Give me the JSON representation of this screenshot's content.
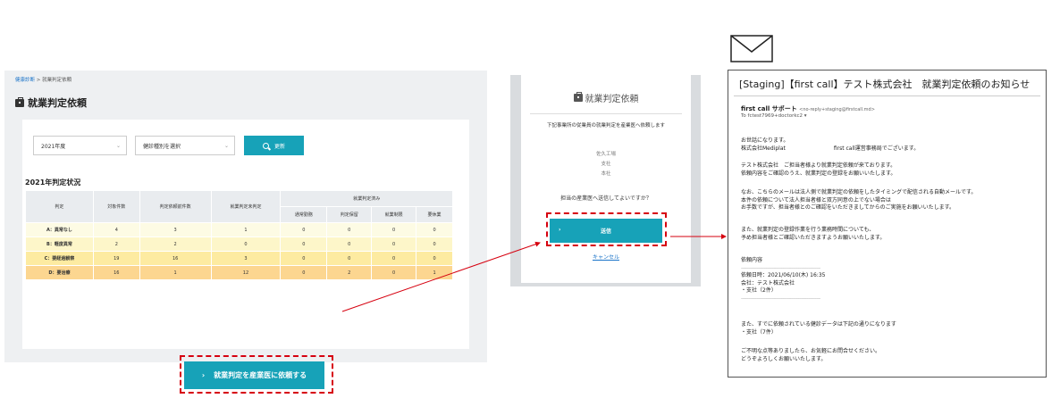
{
  "panel1": {
    "breadcrumb": {
      "link": "健康診断",
      "sep": " > ",
      "current": "就業判定依頼"
    },
    "page_title": "就業判定依頼",
    "filters": {
      "year": "2021年度",
      "exam_type": "健診種別を選択",
      "update_button": "更新"
    },
    "section_title": "2021年判定状況",
    "table": {
      "headers": {
        "judgment": "判定",
        "target": "対象件数",
        "requested": "判定依頼前件数",
        "not_judged": "就業判定未判定",
        "judged_group": "就業判定済み",
        "normal": "通常勤務",
        "hold": "判定保留",
        "restricted": "就業制限",
        "leave": "要休業"
      },
      "rows": [
        {
          "label": "A：異常なし",
          "target": "4",
          "requested": "3",
          "not_judged": "1",
          "normal": "0",
          "hold": "0",
          "restricted": "0",
          "leave": "0"
        },
        {
          "label": "B：軽度異常",
          "target": "2",
          "requested": "2",
          "not_judged": "0",
          "normal": "0",
          "hold": "0",
          "restricted": "0",
          "leave": "0"
        },
        {
          "label": "C：要経過観察",
          "target": "19",
          "requested": "16",
          "not_judged": "3",
          "normal": "0",
          "hold": "0",
          "restricted": "0",
          "leave": "0"
        },
        {
          "label": "D：要治療",
          "target": "16",
          "requested": "1",
          "not_judged": "12",
          "normal": "0",
          "hold": "2",
          "restricted": "0",
          "leave": "1"
        }
      ]
    },
    "request_button": "就業判定を産業医に依頼する"
  },
  "panel2": {
    "title": "就業判定依頼",
    "description": "下記事業所の従業員の就業判定を産業医へ依頼します",
    "offices": [
      "佐久工場",
      "支社",
      "本社"
    ],
    "question": "担当の産業医へ送信してよいですか？",
    "send_button": "送信",
    "cancel": "キャンセル"
  },
  "email": {
    "subject": "[Staging]【first call】テスト株式会社　就業判定依頼のお知らせ",
    "from_name": "first call サポート",
    "from_addr": "<no-reply+staging@firstcall.md>",
    "to": "To fctest7969+doctorkc2",
    "greeting_1": "お世話になります。",
    "greeting_2": "株式会社Mediplat　　　　　　　　　first call運営事務局でございます。",
    "p1_1": "テスト株式会社　ご担当者様より就業判定依頼が来ております。",
    "p1_2": "依頼内容をご確認のうえ、就業判定の登録をお願いいたします。",
    "p2_1": "なお、こちらのメールは法人側で就業判定の依頼をしたタイミングで配信される自動メールです。",
    "p2_2": "本件の依頼について法人担当者様と双方同意の上でない場合は",
    "p2_3": "お手数ですが、担当者様とのご確認をいただきましてからのご実施をお願いいたします。",
    "p3_1": "また、就業判定の登録作業を行う業務時間についても、",
    "p3_2": "予め担当者様とご確認いただきますようお願いいたします。",
    "detail_title": "依頼内容",
    "separator": "----------------------------------------------------------------------------------------------",
    "detail_1": "依頼日時：2021/06/10(木) 16:35",
    "detail_2": "会社：テスト株式会社",
    "detail_3": "・支社（2件）",
    "p4_1": "また、すでに依頼されている健診データは下記の通りになります",
    "p4_2": "・支社（7件）",
    "closing_1": "ご不明な点等ありましたら、お気軽にお問合せください。",
    "closing_2": "どうぞよろしくお願いいたします。"
  },
  "colors": {
    "accent": "#17a2b8",
    "highlight": "#d6000f",
    "row_a": "#fdfbe4",
    "row_b": "#fdf6c9",
    "row_c": "#fdeba1",
    "row_d": "#fcd690"
  },
  "icons": [
    "briefcase-icon",
    "search-icon",
    "chevron-down-icon",
    "chevron-right-icon",
    "envelope-icon",
    "dropdown-caret-icon"
  ]
}
